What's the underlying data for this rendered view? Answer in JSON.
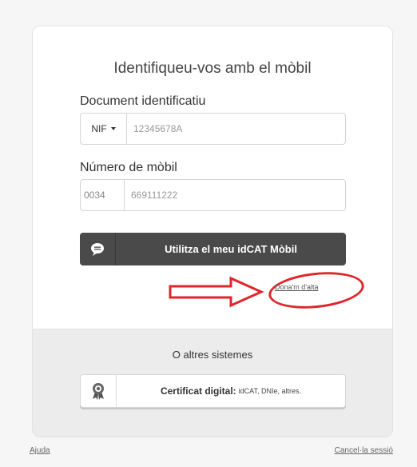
{
  "card": {
    "title": "Identifiqueu-vos amb el mòbil"
  },
  "document": {
    "label": "Document identificatiu",
    "type_selected": "NIF",
    "placeholder": "12345678A"
  },
  "mobile": {
    "label": "Número de mòbil",
    "prefix": "0034",
    "placeholder": "669111222"
  },
  "idcat_button": {
    "label": "Utilitza el meu idCAT Mòbil",
    "icon": "speech-bubble-icon"
  },
  "signup_link": "Dona'm d'alta",
  "other_systems": {
    "title": "O altres sistemes",
    "cert_button": {
      "label_bold": "Certificat digital:",
      "label_rest": "idCAT, DNIe, altres.",
      "icon": "certificate-badge-icon"
    }
  },
  "footer": {
    "help": "Ajuda",
    "cancel": "Cancel·la sessió"
  },
  "colors": {
    "primary_button": "#4a4a4a",
    "annotation_red": "#e0262b",
    "panel_bg": "#ececec"
  }
}
